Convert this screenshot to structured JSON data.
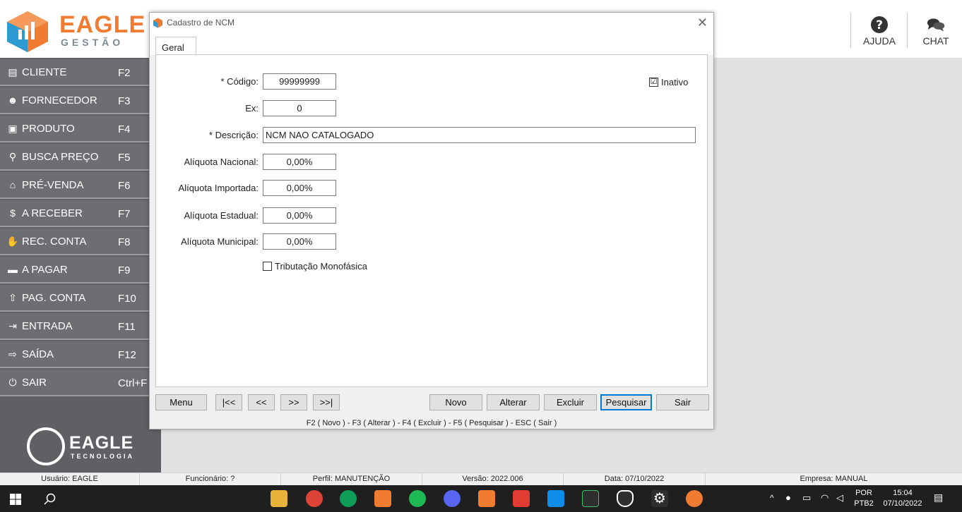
{
  "header": {
    "logo_title": "EAGLE",
    "logo_subtitle": "GESTÃO",
    "help_label": "AJUDA",
    "chat_label": "CHAT"
  },
  "sidebar": {
    "items": [
      {
        "label": "CLIENTE",
        "key": "F2",
        "icon": "client-card-icon"
      },
      {
        "label": "FORNECEDOR",
        "key": "F3",
        "icon": "users-icon"
      },
      {
        "label": "PRODUTO",
        "key": "F4",
        "icon": "box-icon"
      },
      {
        "label": "BUSCA PREÇO",
        "key": "F5",
        "icon": "search-icon"
      },
      {
        "label": "PRÉ-VENDA",
        "key": "F6",
        "icon": "basket-icon"
      },
      {
        "label": "A RECEBER",
        "key": "F7",
        "icon": "dollar-icon"
      },
      {
        "label": "REC. CONTA",
        "key": "F8",
        "icon": "hand-money-icon"
      },
      {
        "label": "A PAGAR",
        "key": "F9",
        "icon": "wallet-icon"
      },
      {
        "label": "PAG. CONTA",
        "key": "F10",
        "icon": "upload-icon"
      },
      {
        "label": "ENTRADA",
        "key": "F11",
        "icon": "sign-in-icon"
      },
      {
        "label": "SAÍDA",
        "key": "F12",
        "icon": "sign-out-icon"
      },
      {
        "label": "SAIR",
        "key": "Ctrl+F",
        "icon": "power-icon"
      }
    ],
    "footer_logo_title": "EAGLE",
    "footer_logo_subtitle": "TECNOLOGIA"
  },
  "dialog": {
    "title": "Cadastro de NCM",
    "tab": "Geral",
    "fields": {
      "codigo_label": "* Código:",
      "codigo_value": "99999999",
      "ex_label": "Ex:",
      "ex_value": "0",
      "descricao_label": "* Descrição:",
      "descricao_value": "NCM NAO CATALOGADO",
      "aliq_nacional_label": "Alíquota Nacional:",
      "aliq_nacional_value": "0,00%",
      "aliq_importada_label": "Alíquota Importada:",
      "aliq_importada_value": "0,00%",
      "aliq_estadual_label": "Alíquota Estadual:",
      "aliq_estadual_value": "0,00%",
      "aliq_municipal_label": "Alíquota Municipal:",
      "aliq_municipal_value": "0,00%"
    },
    "inativo_label": "Inativo",
    "inativo_checked": "☑",
    "monofasica_label": "Tributação Monofásica",
    "buttons": {
      "menu": "Menu",
      "first": "|<<",
      "prev": "<<",
      "next": ">>",
      "last": ">>|",
      "novo": "Novo",
      "alterar": "Alterar",
      "excluir": "Excluir",
      "pesquisar": "Pesquisar",
      "sair": "Sair"
    },
    "shortcut_hint": "F2 ( Novo )  -  F3 ( Alterar )  -  F4 ( Excluir )  -  F5 ( Pesquisar )  -  ESC ( Sair )"
  },
  "statusbar": {
    "usuario": "Usuário: EAGLE",
    "funcionario": "Funcionário: ?",
    "perfil": "Perfil: MANUTENÇÃO",
    "versao": "Versão: 2022.006",
    "data": "Data: 07/10/2022",
    "empresa": "Empresa: MANUAL"
  },
  "taskbar": {
    "lang1": "POR",
    "lang2": "PTB2",
    "time": "15:04",
    "date": "07/10/2022"
  },
  "colors": {
    "brand_orange": "#f07c32",
    "sidebar_bg": "#6d6e71",
    "accent_blue": "#0078d7"
  }
}
